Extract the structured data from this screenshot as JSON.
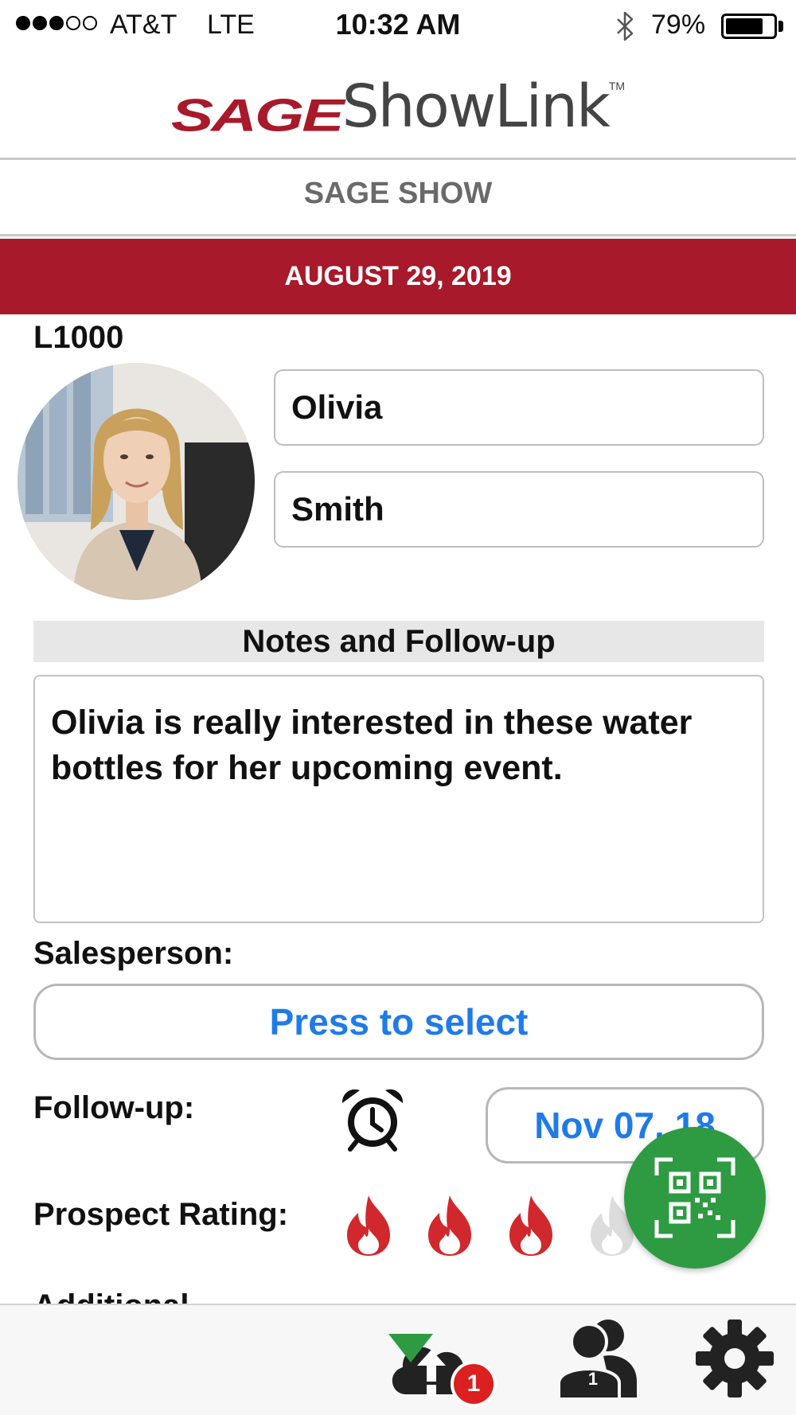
{
  "status_bar": {
    "carrier": "AT&T",
    "network": "LTE",
    "time": "10:32 AM",
    "battery_percent": "79%",
    "battery_level": 0.79,
    "signal_bars_filled": 3,
    "signal_bars_total": 5
  },
  "header": {
    "logo_sage": "SAGE",
    "logo_showlink": "ShowLink",
    "logo_tm": "TM",
    "show_name": "SAGE SHOW",
    "date": "AUGUST 29, 2019",
    "brand_color": "#a8192b"
  },
  "lead": {
    "id": "L1000",
    "first_name": "Olivia",
    "last_name": "Smith"
  },
  "notes": {
    "header": "Notes and Follow-up",
    "text": "Olivia is really interested in these water bottles for her upcoming event."
  },
  "salesperson": {
    "label": "Salesperson:",
    "button_label": "Press to select"
  },
  "followup": {
    "label": "Follow-up:",
    "date": "Nov 07, 18",
    "icon": "alarm-clock-icon"
  },
  "rating": {
    "label": "Prospect Rating:",
    "value": 3,
    "max": 4,
    "active_color": "#d1282d",
    "inactive_color": "#dcdcdc"
  },
  "additional": {
    "label": "Additional"
  },
  "toolbar": {
    "sync_badge": "1",
    "leads_count": "1",
    "accent_color": "#2e9b42"
  }
}
